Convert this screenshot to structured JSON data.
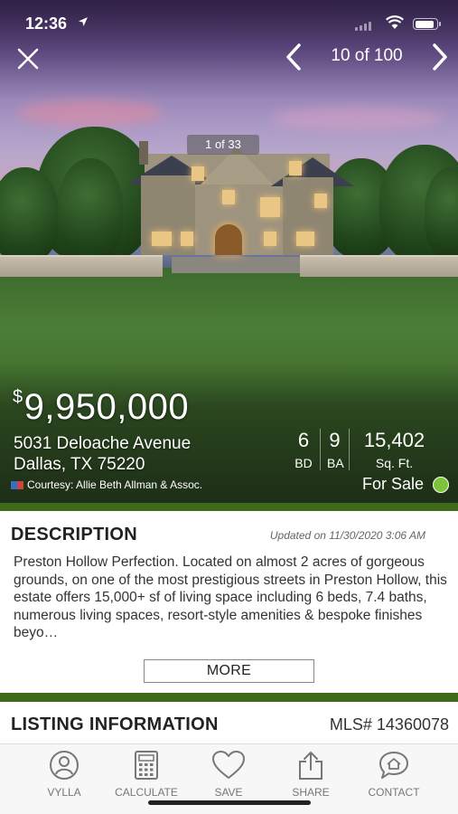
{
  "status_bar": {
    "time": "12:36",
    "location_icon": "location-arrow-icon"
  },
  "nav": {
    "counter": "10 of 100",
    "close_icon": "close-icon",
    "prev_icon": "chevron-left-icon",
    "next_icon": "chevron-right-icon"
  },
  "photo": {
    "counter": "1 of 33"
  },
  "listing": {
    "price_symbol": "$",
    "price": "9,950,000",
    "address_line1": "5031 Deloache Avenue",
    "address_line2": "Dallas, TX 75220",
    "courtesy": "Courtesy: Allie Beth Allman & Assoc.",
    "beds": "6",
    "beds_label": "BD",
    "baths": "9",
    "baths_label": "BA",
    "sqft": "15,402",
    "sqft_label": "Sq. Ft.",
    "status": "For Sale",
    "status_color": "#7ec43a"
  },
  "description": {
    "title": "DESCRIPTION",
    "updated": "Updated on 11/30/2020 3:06 AM",
    "body": "Preston Hollow Perfection. Located on almost 2 acres of gorgeous grounds, on one of the most prestigious streets in Preston Hollow, this estate offers 15,000+ sf of living space including 6 beds, 7.4 baths, numerous living spaces, resort-style amenities & bespoke finishes beyo…",
    "more_label": "MORE"
  },
  "listing_info": {
    "title": "LISTING INFORMATION",
    "mls": "MLS# 14360078"
  },
  "tabs": [
    {
      "label": "VYLLA",
      "icon": "person-icon"
    },
    {
      "label": "CALCULATE",
      "icon": "calculator-icon"
    },
    {
      "label": "SAVE",
      "icon": "heart-icon"
    },
    {
      "label": "SHARE",
      "icon": "share-icon"
    },
    {
      "label": "CONTACT",
      "icon": "chat-home-icon"
    }
  ],
  "colors": {
    "accent_green": "#3f6a1a"
  }
}
